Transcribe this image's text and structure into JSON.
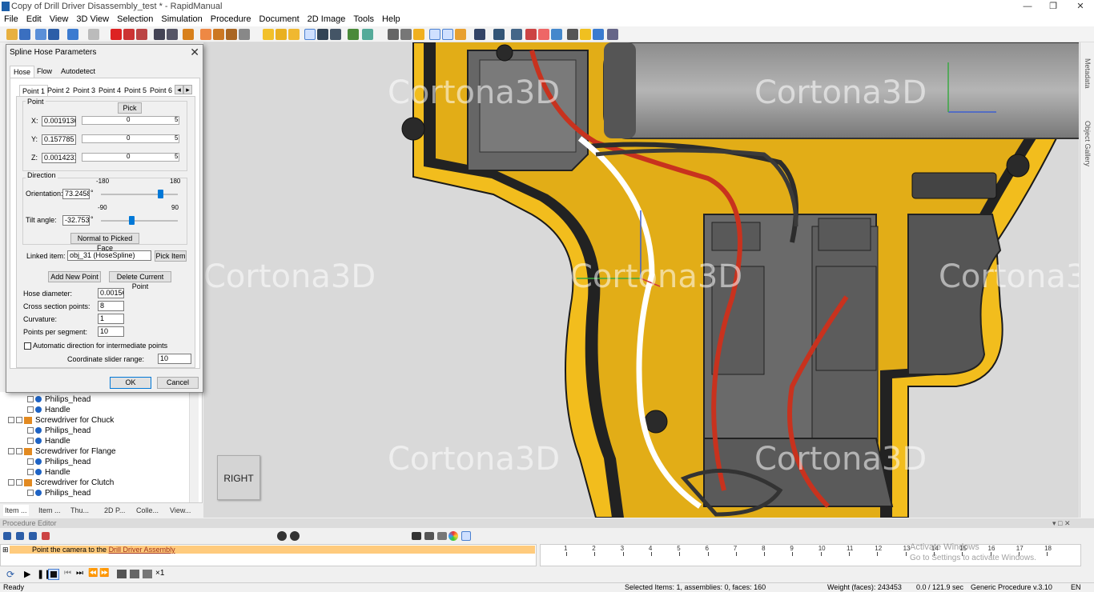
{
  "window": {
    "title": "Copy of Drill Driver Disassembly_test * - RapidManual"
  },
  "menu": {
    "items": [
      "File",
      "Edit",
      "View",
      "3D View",
      "Selection",
      "Simulation",
      "Procedure",
      "Document",
      "2D Image",
      "Tools",
      "Help"
    ]
  },
  "viewport": {
    "watermark": "Cortona3D",
    "view_cube_label": "RIGHT"
  },
  "side_panel": {
    "tabs": [
      "Metadata",
      "Object Gallery"
    ]
  },
  "dialog": {
    "title": "Spline Hose Parameters",
    "tabs": [
      "Hose",
      "Flow",
      "Autodetect"
    ],
    "point_tabs": [
      "Point 1",
      "Point 2",
      "Point 3",
      "Point 4",
      "Point 5",
      "Point 6"
    ],
    "point_group": {
      "label": "Point",
      "pick_button": "Pick",
      "x_label": "X:",
      "x_value": "0.0019136",
      "y_label": "Y:",
      "y_value": "0.157785",
      "z_label": "Z:",
      "z_value": "0.0014231",
      "ruler_min": "0",
      "ruler_max": "5"
    },
    "direction_group": {
      "label": "Direction",
      "orientation_label": "Orientation:",
      "orientation_value": "73.2458",
      "orientation_min": "-180",
      "orientation_max": "180",
      "orientation_level": 0.703,
      "tilt_label": "Tilt angle:",
      "tilt_value": "-32.753",
      "tilt_min": "-90",
      "tilt_max": "90",
      "tilt_level": 0.318,
      "degree": "°",
      "normal_button": "Normal to Picked Face"
    },
    "linked_item_label": "Linked item:",
    "linked_item_value": "obj_31 (HoseSpline)",
    "pick_item_button": "Pick Item",
    "add_point_button": "Add New Point",
    "delete_point_button": "Delete Current Point",
    "hose_diameter_label": "Hose diameter:",
    "hose_diameter_value": "0.0015C",
    "cross_section_label": "Cross section points:",
    "cross_section_value": "8",
    "curvature_label": "Curvature:",
    "curvature_value": "1",
    "points_per_segment_label": "Points per segment:",
    "points_per_segment_value": "10",
    "auto_direction_label": "Automatic direction for intermediate points",
    "slider_range_label": "Coordinate slider range:",
    "slider_range_value": "10",
    "ok_button": "OK",
    "cancel_button": "Cancel"
  },
  "tree": {
    "rows": [
      {
        "label": "Philips_head",
        "kind": "part"
      },
      {
        "label": "Handle",
        "kind": "part"
      },
      {
        "label": "Screwdriver for Chuck",
        "kind": "assembly"
      },
      {
        "label": "Philips_head",
        "kind": "part"
      },
      {
        "label": "Handle",
        "kind": "part"
      },
      {
        "label": "Screwdriver for Flange",
        "kind": "assembly"
      },
      {
        "label": "Philips_head",
        "kind": "part"
      },
      {
        "label": "Handle",
        "kind": "part"
      },
      {
        "label": "Screwdriver for Clutch",
        "kind": "assembly"
      },
      {
        "label": "Philips_head",
        "kind": "part"
      }
    ],
    "tabs": [
      "Item ...",
      "Item ...",
      "Thu...",
      "2D P...",
      "Colle...",
      "View..."
    ]
  },
  "procedure": {
    "header": "Procedure Editor",
    "row_prefix": "Point the camera to the ",
    "row_link": "Drill Driver Assembly",
    "timeline_labels": [
      "1",
      "2",
      "3",
      "4",
      "5",
      "6",
      "7",
      "8",
      "9",
      "10",
      "11",
      "12",
      "13",
      "14",
      "15",
      "16",
      "17",
      "18"
    ],
    "activate_line1": "Activate Windows",
    "activate_line2": "Go to Settings to activate Windows."
  },
  "status": {
    "ready": "Ready",
    "selected": "Selected Items: 1, assemblies: 0, faces: 160",
    "weight": "Weight (faces): 243453",
    "time": "0.0 / 121.9 sec",
    "procedure": "Generic Procedure v.3.10",
    "lang": "EN"
  },
  "colors": {
    "drill_yellow": "#f2bd1d",
    "wire_red": "#c8321e",
    "accent_blue": "#0078d7",
    "proc_highlight": "#ffcb7d"
  }
}
